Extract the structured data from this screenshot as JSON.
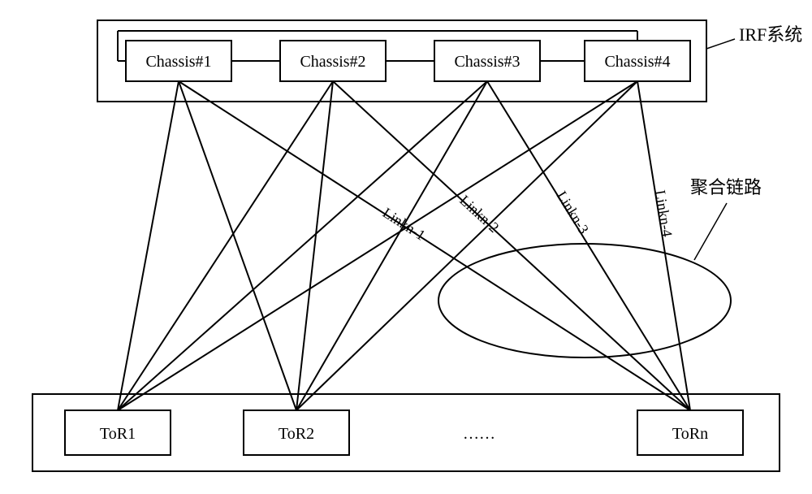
{
  "irf_label": "IRF系统",
  "chassis": {
    "c1": "Chassis#1",
    "c2": "Chassis#2",
    "c3": "Chassis#3",
    "c4": "Chassis#4"
  },
  "tor": {
    "t1": "ToR1",
    "t2": "ToR2",
    "ellipsis": "……",
    "tn": "ToRn"
  },
  "links": {
    "l1": "Linkn-1",
    "l2": "Linkn-2",
    "l3": "Linkn-3",
    "l4": "Linkn-4"
  },
  "agg_label": "聚合链路"
}
